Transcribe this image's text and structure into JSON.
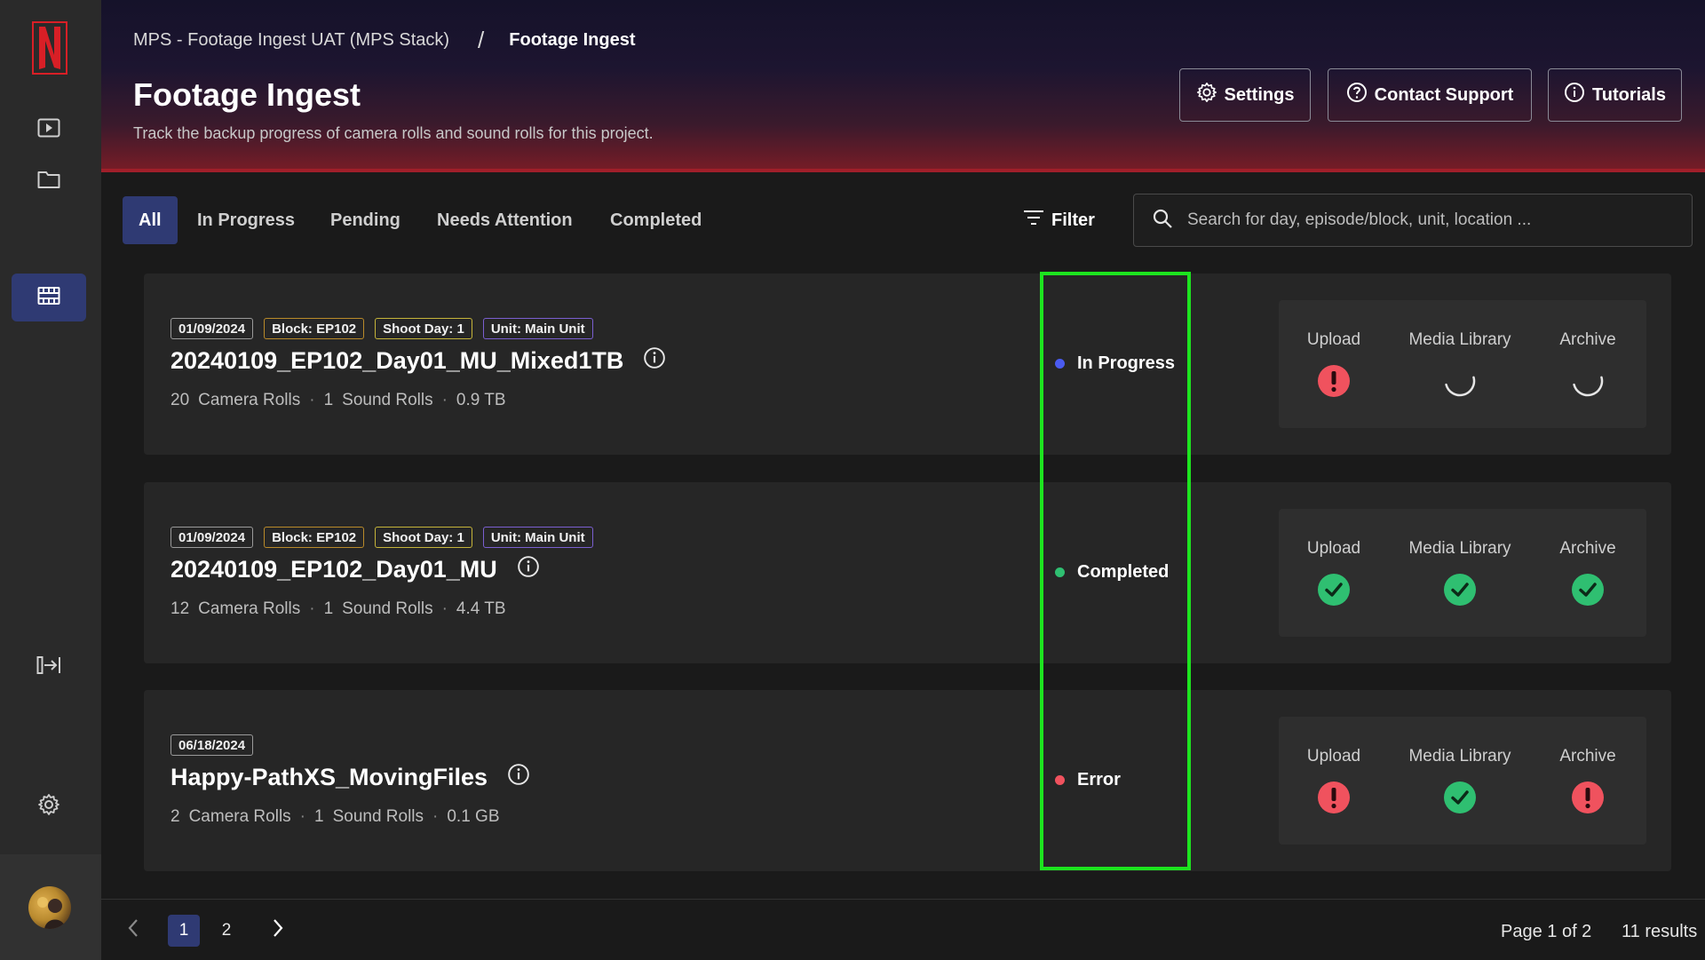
{
  "breadcrumb": {
    "project": "MPS - Footage Ingest UAT (MPS Stack)",
    "separator": "/",
    "current": "Footage Ingest"
  },
  "header": {
    "title": "Footage Ingest",
    "subtitle": "Track the backup progress of camera rolls and sound rolls for this project.",
    "buttons": {
      "settings": "Settings",
      "support": "Contact Support",
      "tutorials": "Tutorials"
    }
  },
  "tabs": [
    "All",
    "In Progress",
    "Pending",
    "Needs Attention",
    "Completed"
  ],
  "filter_label": "Filter",
  "search": {
    "placeholder": "Search for day, episode/block, unit, location ..."
  },
  "colors": {
    "accent": "#2f3a73",
    "in_progress": "#4a5bf0",
    "completed": "#2fbf71",
    "error": "#f0525e",
    "highlight": "#1de41f"
  },
  "cards": [
    {
      "tags": {
        "date": "01/09/2024",
        "block": "Block: EP102",
        "day": "Shoot Day: 1",
        "unit": "Unit: Main Unit"
      },
      "title": "20240109_EP102_Day01_MU_Mixed1TB",
      "camera": "20",
      "camera_label": "Camera Rolls",
      "sound": "1",
      "sound_label": "Sound Rolls",
      "size": "0.9 TB",
      "status": "In Progress",
      "steps": [
        {
          "label": "Upload",
          "state": "error-icon"
        },
        {
          "label": "Media Library",
          "state": "spinner-icon"
        },
        {
          "label": "Archive",
          "state": "spinner-icon"
        }
      ]
    },
    {
      "tags": {
        "date": "01/09/2024",
        "block": "Block: EP102",
        "day": "Shoot Day: 1",
        "unit": "Unit: Main Unit"
      },
      "title": "20240109_EP102_Day01_MU",
      "camera": "12",
      "camera_label": "Camera Rolls",
      "sound": "1",
      "sound_label": "Sound Rolls",
      "size": "4.4 TB",
      "status": "Completed",
      "steps": [
        {
          "label": "Upload",
          "state": "check-icon"
        },
        {
          "label": "Media Library",
          "state": "check-icon"
        },
        {
          "label": "Archive",
          "state": "check-icon"
        }
      ]
    },
    {
      "tags": {
        "date": "06/18/2024"
      },
      "title": "Happy-PathXS_MovingFiles",
      "camera": "2",
      "camera_label": "Camera Rolls",
      "sound": "1",
      "sound_label": "Sound Rolls",
      "size": "0.1 GB",
      "status": "Error",
      "steps": [
        {
          "label": "Upload",
          "state": "error-icon"
        },
        {
          "label": "Media Library",
          "state": "check-icon"
        },
        {
          "label": "Archive",
          "state": "error-icon"
        }
      ]
    }
  ],
  "pagination": {
    "pages": [
      "1",
      "2"
    ],
    "current": "1",
    "page_info": "Page 1 of 2",
    "results": "11 results"
  }
}
